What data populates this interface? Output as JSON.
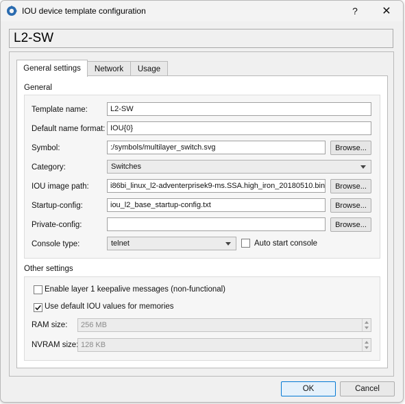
{
  "window": {
    "title": "IOU device template configuration",
    "help_glyph": "?",
    "close_glyph": "✕"
  },
  "template_name_display": "L2-SW",
  "tabs": [
    {
      "label": "General settings",
      "active": true
    },
    {
      "label": "Network",
      "active": false
    },
    {
      "label": "Usage",
      "active": false
    }
  ],
  "general": {
    "section_title": "General",
    "template_name": {
      "label": "Template name:",
      "value": "L2-SW"
    },
    "default_name_format": {
      "label": "Default name format:",
      "value": "IOU{0}"
    },
    "symbol": {
      "label": "Symbol:",
      "value": ":/symbols/multilayer_switch.svg",
      "browse": "Browse..."
    },
    "category": {
      "label": "Category:",
      "value": "Switches"
    },
    "iou_image_path": {
      "label": "IOU image path:",
      "value": "i86bi_linux_l2-adventerprisek9-ms.SSA.high_iron_20180510.bin",
      "browse": "Browse..."
    },
    "startup_config": {
      "label": "Startup-config:",
      "value": "iou_l2_base_startup-config.txt",
      "browse": "Browse..."
    },
    "private_config": {
      "label": "Private-config:",
      "value": "",
      "browse": "Browse..."
    },
    "console_type": {
      "label": "Console type:",
      "value": "telnet"
    },
    "auto_start_console": {
      "label": "Auto start console",
      "checked": false
    }
  },
  "other": {
    "section_title": "Other settings",
    "enable_l1_keepalive": {
      "label": "Enable layer 1 keepalive messages (non-functional)",
      "checked": false
    },
    "use_default_iou_values": {
      "label": "Use default IOU values for memories",
      "checked": true
    },
    "ram_size": {
      "label": "RAM size:",
      "value": "256 MB"
    },
    "nvram_size": {
      "label": "NVRAM size:",
      "value": "128 KB"
    }
  },
  "footer": {
    "ok": "OK",
    "cancel": "Cancel"
  },
  "icons": {
    "app": "gns3-app-icon",
    "checkmark": "check-icon"
  }
}
